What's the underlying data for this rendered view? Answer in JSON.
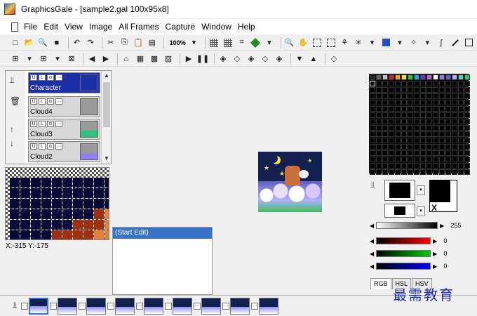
{
  "title": "GraphicsGale - [sample2.gal 100x95x8]",
  "menu": [
    "File",
    "Edit",
    "View",
    "Image",
    "All Frames",
    "Capture",
    "Window",
    "Help"
  ],
  "toolbar": {
    "zoom_label": "100%"
  },
  "layers": [
    {
      "name": "Character",
      "active": true
    },
    {
      "name": "Cloud4",
      "active": false
    },
    {
      "name": "Cloud3",
      "active": false
    },
    {
      "name": "Cloud2",
      "active": false
    }
  ],
  "layer_icons": {
    "visible": "U",
    "lock": "L",
    "alpha": "α",
    "more": "···"
  },
  "coords": "X:-315 Y:-175",
  "history": [
    "(Start Edit)"
  ],
  "color": {
    "gray_value": "255",
    "r_value": "0",
    "g_value": "0",
    "b_value": "0",
    "x_mark": "X"
  },
  "tabs": [
    "RGB",
    "HSL",
    "HSV"
  ],
  "frames_count": 9,
  "watermark": "最需教育",
  "colors": {
    "active_layer": "#1c2ea8",
    "selection": "#3a72c8",
    "magnifier_dark": "#0a0a3a",
    "magnifier_brown": "#a03010",
    "magnifier_orange": "#e08040"
  }
}
